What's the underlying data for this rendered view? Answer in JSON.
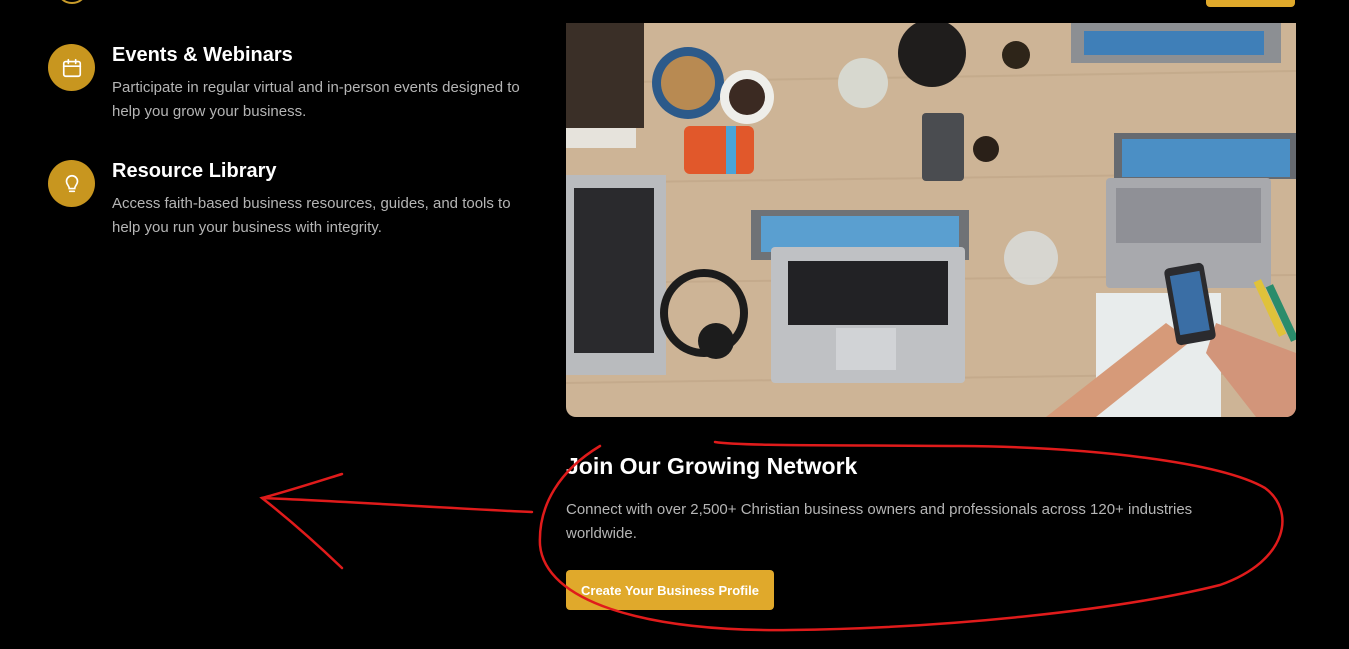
{
  "features": [
    {
      "icon": "calendar-icon",
      "title": "Events & Webinars",
      "description": "Participate in regular virtual and in-person events designed to help you grow your business."
    },
    {
      "icon": "lightbulb-icon",
      "title": "Resource Library",
      "description": "Access faith-based business resources, guides, and tools to help you run your business with integrity."
    }
  ],
  "cta": {
    "heading": "Join Our Growing Network",
    "text": "Connect with over 2,500+ Christian business owners and professionals across 120+ industries worldwide.",
    "button_label": "Create Your Business Profile"
  },
  "colors": {
    "accent": "#e0a92b",
    "icon_circle": "#c8961f",
    "annotation": "#e01b1b",
    "background": "#000000"
  }
}
